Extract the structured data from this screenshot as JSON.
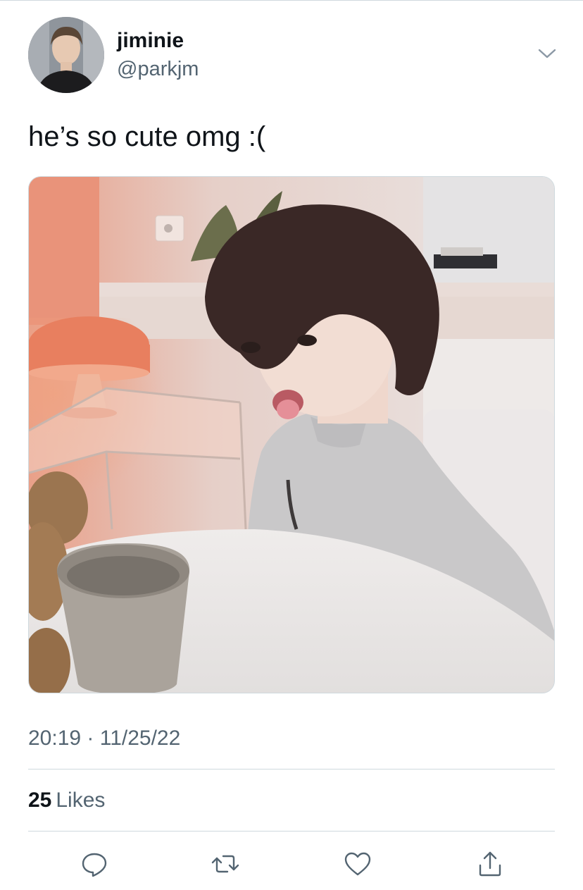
{
  "tweet": {
    "author": {
      "display_name": "jiminie",
      "handle": "@parkjm",
      "avatar_icon": "user-avatar"
    },
    "text": "he’s so cute omg :(",
    "media": {
      "type": "photo"
    },
    "timestamp": "20:19 · 11/25/22",
    "likes": {
      "count": "25",
      "label": "Likes"
    }
  },
  "actions": {
    "reply_icon": "reply-icon",
    "retweet_icon": "retweet-icon",
    "like_icon": "heart-icon",
    "share_icon": "share-icon"
  },
  "colors": {
    "text_primary": "#0f1419",
    "text_secondary": "#536471",
    "divider": "#cfd9de",
    "icon": "#536471"
  }
}
